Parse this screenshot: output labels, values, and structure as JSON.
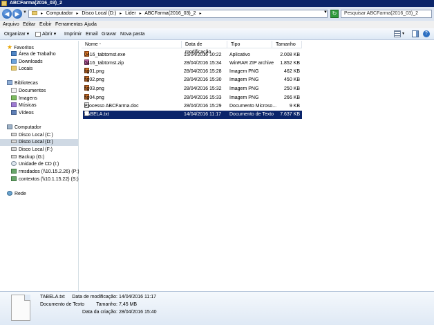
{
  "window": {
    "title": "ABCFarma(2016_03)_2",
    "app_icon": "folder-icon"
  },
  "address": {
    "crumbs": [
      "Computador",
      "Disco Local (D:)",
      "Lider",
      "ABCFarma(2016_03)_2"
    ],
    "search_placeholder": "Pesquisar ABCFarma(2016_03)_2"
  },
  "menu": {
    "items": [
      "Arquivo",
      "Editar",
      "Exibir",
      "Ferramentas",
      "Ajuda"
    ]
  },
  "toolbar": {
    "organize": "Organizar",
    "open": "Abrir",
    "print": "Imprimir",
    "email": "Email",
    "burn": "Gravar",
    "new_folder": "Nova pasta"
  },
  "sidebar": {
    "favorites": {
      "title": "Favoritos",
      "items": [
        "Área de Trabalho",
        "Downloads",
        "Locais"
      ]
    },
    "libraries": {
      "title": "Bibliotecas",
      "items": [
        "Documentos",
        "Imagens",
        "Músicas",
        "Vídeos"
      ]
    },
    "computer": {
      "title": "Computador",
      "items": [
        "Disco Local (C:)",
        "Disco Local (D:)",
        "Disco Local (F:)",
        "Backup (G:)",
        "Unidade de CD (I:)",
        "rmsdados (\\\\10.15.2.26) (P:)",
        "contextos (\\\\10.1.15.22) (S:)"
      ],
      "selected_index": 1
    },
    "network": {
      "title": "Rede"
    }
  },
  "columns": {
    "name": "Nome",
    "modified": "Data de modificação",
    "type": "Tipo",
    "size": "Tamanho"
  },
  "files": [
    {
      "name": "0416_tabtomst.exe",
      "modified": "15/04/2016 10:22",
      "type": "Aplicativo",
      "size": "2.008 KB",
      "icon": "exe-icon"
    },
    {
      "name": "0416_tabtomst.zip",
      "modified": "28/04/2016 15:34",
      "type": "WinRAR ZIP archive",
      "size": "1.852 KB",
      "icon": "zip-icon"
    },
    {
      "name": "fig01.png",
      "modified": "28/04/2016 15:28",
      "type": "Imagem PNG",
      "size": "462 KB",
      "icon": "png-icon"
    },
    {
      "name": "fig02.png",
      "modified": "28/04/2016 15:30",
      "type": "Imagem PNG",
      "size": "450 KB",
      "icon": "png-icon"
    },
    {
      "name": "fig03.png",
      "modified": "28/04/2016 15:32",
      "type": "Imagem PNG",
      "size": "250 KB",
      "icon": "png-icon"
    },
    {
      "name": "fig04.png",
      "modified": "28/04/2016 15:33",
      "type": "Imagem PNG",
      "size": "266 KB",
      "icon": "png-icon"
    },
    {
      "name": "Processo ABCFarma.doc",
      "modified": "28/04/2016 15:29",
      "type": "Documento Microso...",
      "size": "9 KB",
      "icon": "doc-icon"
    },
    {
      "name": "TABELA.txt",
      "modified": "14/04/2016 11:17",
      "type": "Documento de Texto",
      "size": "7.637 KB",
      "icon": "txt-icon",
      "selected": true
    }
  ],
  "details": {
    "name": "TABELA.txt",
    "kind": "Documento de Texto",
    "modified_label": "Data de modificação:",
    "modified_value": "14/04/2016 11:17",
    "size_label": "Tamanho:",
    "size_value": "7,45 MB",
    "created_label": "Data da criação:",
    "created_value": "28/04/2016 15:40"
  },
  "colors": {
    "selection": "#0a246a",
    "titlebar": "#0a246a",
    "toolbar_gradient_top": "#f6f9fd",
    "toolbar_gradient_bottom": "#dde8f5"
  }
}
